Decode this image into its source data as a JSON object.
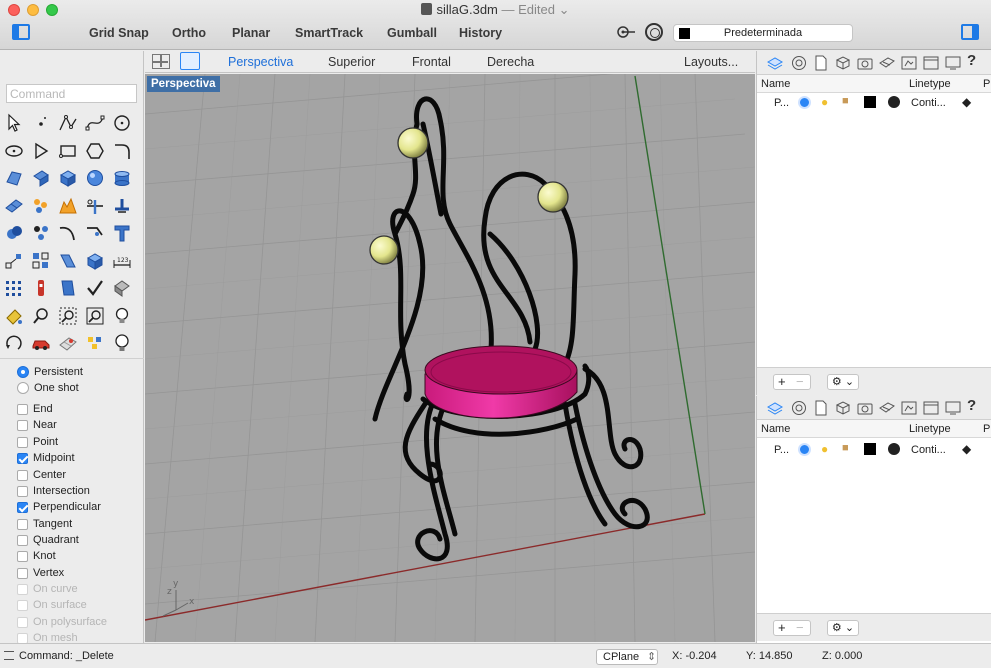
{
  "window": {
    "file_name": "sillaG.3dm",
    "edited_label": "Edited",
    "title_separator": "—"
  },
  "toolbar": {
    "buttons": [
      "Grid Snap",
      "Ortho",
      "Planar",
      "SmartTrack",
      "Gumball",
      "History"
    ],
    "layer_name": "Predeterminada"
  },
  "command": {
    "placeholder": "Command",
    "history": "Command: _Delete"
  },
  "osnap": {
    "mode_options": [
      {
        "label": "Persistent",
        "selected": true
      },
      {
        "label": "One shot",
        "selected": false
      }
    ],
    "snaps": [
      {
        "label": "End",
        "checked": false,
        "enabled": true
      },
      {
        "label": "Near",
        "checked": false,
        "enabled": true
      },
      {
        "label": "Point",
        "checked": false,
        "enabled": true
      },
      {
        "label": "Midpoint",
        "checked": true,
        "enabled": true
      },
      {
        "label": "Center",
        "checked": false,
        "enabled": true
      },
      {
        "label": "Intersection",
        "checked": false,
        "enabled": true
      },
      {
        "label": "Perpendicular",
        "checked": true,
        "enabled": true
      },
      {
        "label": "Tangent",
        "checked": false,
        "enabled": true
      },
      {
        "label": "Quadrant",
        "checked": false,
        "enabled": true
      },
      {
        "label": "Knot",
        "checked": false,
        "enabled": true
      },
      {
        "label": "Vertex",
        "checked": false,
        "enabled": true
      },
      {
        "label": "On curve",
        "checked": false,
        "enabled": false
      },
      {
        "label": "On surface",
        "checked": false,
        "enabled": false
      },
      {
        "label": "On polysurface",
        "checked": false,
        "enabled": false
      },
      {
        "label": "On mesh",
        "checked": false,
        "enabled": false
      }
    ]
  },
  "viewport": {
    "tabs": [
      "Perspectiva",
      "Superior",
      "Frontal",
      "Derecha"
    ],
    "active_tab": "Perspectiva",
    "layouts_label": "Layouts...",
    "label": "Perspectiva",
    "axis_x": "x",
    "axis_y": "y",
    "axis_z": "z",
    "colors": {
      "background": "#a4a4a4",
      "seat_top": "#b0125e",
      "seat_side": "#e0279a",
      "balls": "#e3e58d",
      "wire": "#0a0a0a",
      "x_axis": "#8b2a2a",
      "y_axis": "#2f6b2f"
    }
  },
  "layers_panel": {
    "columns": {
      "name": "Name",
      "linetype": "Linetype",
      "print": "Pr"
    },
    "row": {
      "name": "P...",
      "linetype": "Conti..."
    },
    "help": "?"
  },
  "statusbar": {
    "cplane": "CPlane",
    "x": "X: -0.204",
    "y": "Y: 14.850",
    "z": "Z: 0.000"
  }
}
